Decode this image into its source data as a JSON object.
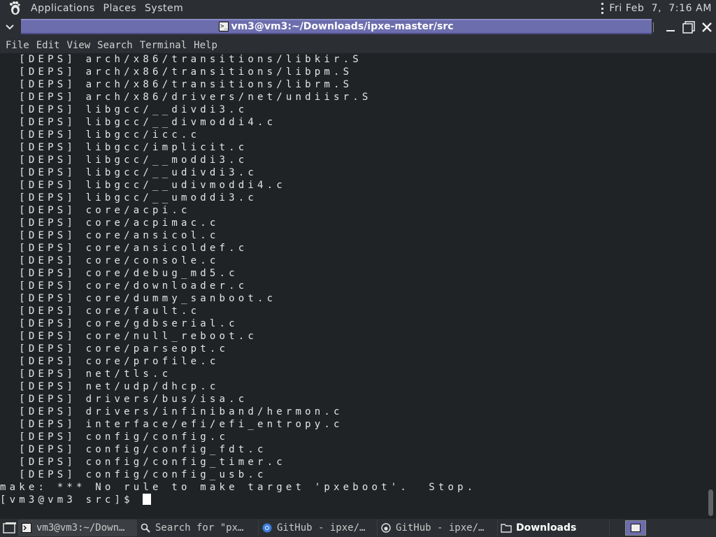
{
  "top_panel": {
    "menus": [
      "Applications",
      "Places",
      "System"
    ],
    "clock": "Fri Feb  7,  7:16 AM",
    "logo_icon": "gnome-foot-icon"
  },
  "window": {
    "title": "vm3@vm3:~/Downloads/ipxe-master/src"
  },
  "terminal_menu": [
    "File",
    "Edit",
    "View",
    "Search",
    "Terminal",
    "Help"
  ],
  "terminal": {
    "lines": [
      "  [DEPS] arch/x86/transitions/libkir.S",
      "  [DEPS] arch/x86/transitions/libpm.S",
      "  [DEPS] arch/x86/transitions/librm.S",
      "  [DEPS] arch/x86/drivers/net/undiisr.S",
      "  [DEPS] libgcc/__divdi3.c",
      "  [DEPS] libgcc/__divmoddi4.c",
      "  [DEPS] libgcc/icc.c",
      "  [DEPS] libgcc/implicit.c",
      "  [DEPS] libgcc/__moddi3.c",
      "  [DEPS] libgcc/__udivdi3.c",
      "  [DEPS] libgcc/__udivmoddi4.c",
      "  [DEPS] libgcc/__umoddi3.c",
      "  [DEPS] core/acpi.c",
      "  [DEPS] core/acpimac.c",
      "  [DEPS] core/ansicol.c",
      "  [DEPS] core/ansicoldef.c",
      "  [DEPS] core/console.c",
      "  [DEPS] core/debug_md5.c",
      "  [DEPS] core/downloader.c",
      "  [DEPS] core/dummy_sanboot.c",
      "  [DEPS] core/fault.c",
      "  [DEPS] core/gdbserial.c",
      "  [DEPS] core/null_reboot.c",
      "  [DEPS] core/parseopt.c",
      "  [DEPS] core/profile.c",
      "  [DEPS] net/tls.c",
      "  [DEPS] net/udp/dhcp.c",
      "  [DEPS] drivers/bus/isa.c",
      "  [DEPS] drivers/infiniband/hermon.c",
      "  [DEPS] interface/efi/efi_entropy.c",
      "  [DEPS] config/config.c",
      "  [DEPS] config/config_fdt.c",
      "  [DEPS] config/config_timer.c",
      "  [DEPS] config/config_usb.c",
      "make: *** No rule to make target 'pxeboot'.  Stop."
    ],
    "prompt": "[vm3@vm3 src]$ "
  },
  "taskbar": {
    "tasks": [
      {
        "label": "vm3@vm3:~/Down…",
        "icon": "terminal-icon"
      },
      {
        "label": "Search for \"px…",
        "icon": "search-icon"
      },
      {
        "label": "GitHub - ipxe/…",
        "icon": "chrome-icon"
      },
      {
        "label": "GitHub - ipxe/…",
        "icon": "gnome-foot-icon"
      },
      {
        "label": "Downloads",
        "icon": "folder-icon"
      }
    ]
  }
}
